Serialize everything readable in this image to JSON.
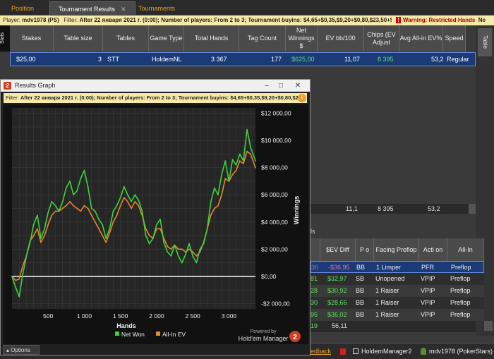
{
  "tabs": [
    {
      "label": "Position"
    },
    {
      "label": "Tournament Results",
      "close": "✕"
    },
    {
      "label": "Tournaments"
    }
  ],
  "filter_bar": {
    "player_label": "Player:",
    "player": "mdv1978 (PS)",
    "filter_label": "Filter:",
    "filter": "After 22 января 2021 г. (0:00); Number of players: From 2 to 3; Tournament buyins: $4,65+$0,35,$9,20+$0,80,$23,50+$1,50",
    "warning_icon": "!",
    "warning": "Warning: Restricted Hands",
    "overflow": "Ne"
  },
  "side_tabs": {
    "stats": "Stats",
    "table": "Table"
  },
  "stats_table": {
    "headers": [
      "Stakes",
      "Table size",
      "Tables",
      "Game Type",
      "Total Hands",
      "Tag Count",
      "Net Winnings $",
      "EV bb/100",
      "Chips (EV Adjust",
      "Avg All-in EV%",
      "Speed"
    ],
    "row": [
      "$25,00",
      "3",
      "STT",
      "HoldemNL",
      "3 367",
      "177",
      "$625,00",
      "11,07",
      "8 395",
      "53,2",
      "Regular"
    ]
  },
  "totals": [
    "11,1",
    "8 395",
    "53,2"
  ],
  "hands_panel": {
    "title_frag": "ls",
    "headers": [
      "$EV Diff",
      "P o",
      "Facing Preflop",
      "Acti on",
      "All-In"
    ],
    "rows": [
      {
        "frag": "36",
        "ev": "-$36,95",
        "pos": "BB",
        "facing": "1 Limper",
        "action": "PFR",
        "allin": "Preflop",
        "selected": true
      },
      {
        "frag": "81",
        "ev": "$32,97",
        "pos": "SB",
        "facing": "Unopened",
        "action": "VPIP",
        "allin": "Preflop"
      },
      {
        "frag": "28",
        "ev": "$30,92",
        "pos": "BB",
        "facing": "1 Raiser",
        "action": "VPIP",
        "allin": "Preflop"
      },
      {
        "frag": "30",
        "ev": "$28,66",
        "pos": "BB",
        "facing": "1 Raiser",
        "action": "VPIP",
        "allin": "Preflop"
      },
      {
        "frag": "95",
        "ev": "$36,02",
        "pos": "BB",
        "facing": "1 Raiser",
        "action": "VPIP",
        "allin": "Preflop"
      }
    ],
    "footer_frag": "19",
    "footer_value": "56,11"
  },
  "statusbar": {
    "feedback": "edback",
    "app": "HoldemManager2",
    "user": "mdv1978 (PokerStars)"
  },
  "graph_window": {
    "icon": "2",
    "title": "Results Graph",
    "buttons": [
      "–",
      "□",
      "✕"
    ],
    "filter_label": "Filter:",
    "filter": "After 22 января 2021 г. (0:00); Number of players: From 2 to 3; Tournament buyins: $4,65+$0,35,$9,20+$0,80,$23",
    "info": "i",
    "options": "Options",
    "powered_by": "Powered by",
    "brand": "Hold'em Manager",
    "brand_badge": "2"
  },
  "chart_data": {
    "type": "line",
    "xlabel": "Hands",
    "ylabel": "Winnings",
    "xlim": [
      0,
      3367
    ],
    "ylim": [
      -2400,
      12400
    ],
    "x_ticks": [
      500,
      1000,
      1500,
      2000,
      2500,
      3000
    ],
    "x_tick_labels": [
      "500",
      "1 000",
      "1 500",
      "2 000",
      "2 500",
      "3 000"
    ],
    "y_ticks": [
      12000,
      10000,
      8000,
      6000,
      4000,
      2000,
      0,
      -2000
    ],
    "y_tick_labels": [
      "$12 000,00",
      "$10 000,00",
      "$8 000,00",
      "$6 000,00",
      "$4 000,00",
      "$2 000,00",
      "$0,00",
      "-$2 000,00"
    ],
    "grid": true,
    "legend": "bottom-right",
    "series": [
      {
        "name": "Net Won",
        "color": "#3cd43c",
        "x": [
          0,
          50,
          100,
          150,
          200,
          250,
          300,
          350,
          400,
          450,
          500,
          550,
          600,
          650,
          700,
          750,
          800,
          850,
          900,
          950,
          1000,
          1050,
          1100,
          1150,
          1200,
          1250,
          1300,
          1350,
          1400,
          1450,
          1500,
          1550,
          1600,
          1650,
          1700,
          1750,
          1800,
          1850,
          1900,
          1950,
          2000,
          2050,
          2100,
          2150,
          2200,
          2250,
          2300,
          2350,
          2400,
          2450,
          2500,
          2550,
          2600,
          2650,
          2700,
          2750,
          2800,
          2850,
          2900,
          2950,
          3000,
          3050,
          3100,
          3150,
          3200,
          3250,
          3300,
          3367
        ],
        "y": [
          0,
          -800,
          -1500,
          200,
          1500,
          2500,
          3800,
          4500,
          2800,
          3500,
          4700,
          5500,
          5200,
          4800,
          5500,
          6500,
          7000,
          6000,
          6300,
          7200,
          7800,
          6600,
          5000,
          4800,
          4200,
          3800,
          2800,
          3500,
          4800,
          5200,
          5800,
          6600,
          6000,
          5500,
          6000,
          5600,
          4800,
          3000,
          2400,
          2800,
          3800,
          4200,
          2500,
          1800,
          1500,
          2300,
          1500,
          1000,
          1600,
          2400,
          1500,
          1000,
          2000,
          2400,
          3500,
          5500,
          6500,
          6000,
          7500,
          8500,
          7000,
          8600,
          8200,
          9000,
          8500,
          10800,
          9500,
          8500
        ]
      },
      {
        "name": "All-In EV",
        "color": "#e8862a",
        "x": [
          0,
          50,
          100,
          150,
          200,
          250,
          300,
          350,
          400,
          450,
          500,
          550,
          600,
          650,
          700,
          750,
          800,
          850,
          900,
          950,
          1000,
          1050,
          1100,
          1150,
          1200,
          1250,
          1300,
          1350,
          1400,
          1450,
          1500,
          1550,
          1600,
          1650,
          1700,
          1750,
          1800,
          1850,
          1900,
          1950,
          2000,
          2050,
          2100,
          2150,
          2200,
          2250,
          2300,
          2350,
          2400,
          2450,
          2500,
          2550,
          2600,
          2650,
          2700,
          2750,
          2800,
          2850,
          2900,
          2950,
          3000,
          3050,
          3100,
          3150,
          3200,
          3250,
          3300,
          3367
        ],
        "y": [
          0,
          -300,
          -200,
          800,
          1500,
          2600,
          3000,
          3500,
          2500,
          3000,
          3800,
          4500,
          4800,
          4800,
          5000,
          5200,
          5500,
          5200,
          5000,
          4800,
          5200,
          5000,
          4500,
          4000,
          3500,
          3000,
          2500,
          3200,
          4000,
          4500,
          5200,
          5800,
          5500,
          5000,
          5500,
          5200,
          4500,
          3500,
          3000,
          2800,
          3500,
          3500,
          2800,
          2200,
          2000,
          2300,
          2000,
          2000,
          1800,
          2000,
          1800,
          1500,
          1800,
          2500,
          3500,
          4500,
          5000,
          5200,
          6000,
          7200,
          7000,
          7500,
          7800,
          8500,
          8300,
          9200,
          9000,
          8000
        ]
      }
    ]
  }
}
